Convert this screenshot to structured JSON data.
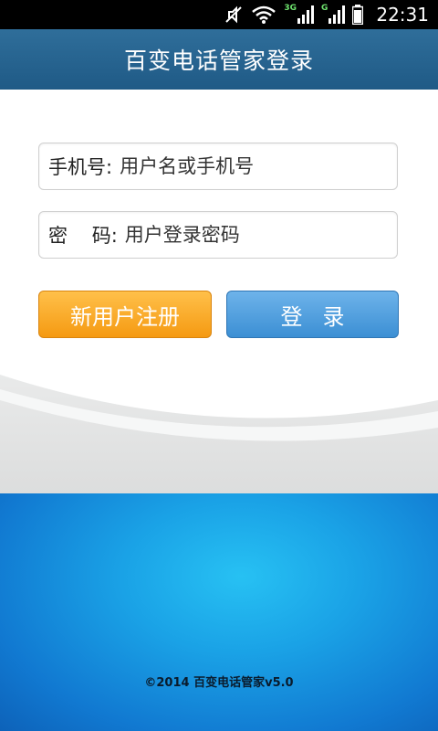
{
  "status_bar": {
    "time": "22:31",
    "network_3g": "3G",
    "network_g": "G",
    "icons": [
      "mute-icon",
      "wifi-icon",
      "signal-3g-icon",
      "signal-g-icon",
      "battery-icon"
    ]
  },
  "header": {
    "title": "百变电话管家登录"
  },
  "form": {
    "phone_label": "手机号:",
    "phone_placeholder": "用户名或手机号",
    "password_label": "密    码:",
    "password_placeholder": "用户登录密码",
    "register_label": "新用户注册",
    "login_label": "登录"
  },
  "footer": {
    "copyright": "©2014 百变电话管家v5.0"
  },
  "colors": {
    "header": "#2f6e9a",
    "register_button": "#f7a520",
    "login_button": "#4d9ddd",
    "bottom_blue": "#1aa2e6"
  }
}
